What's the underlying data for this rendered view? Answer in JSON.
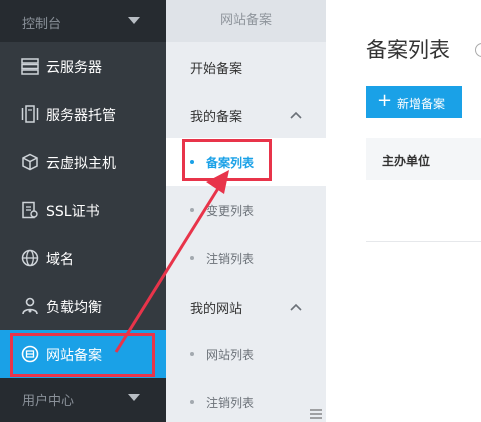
{
  "sidebar": {
    "console_label": "控制台",
    "items": [
      {
        "label": "云服务器",
        "icon": "server-list-icon"
      },
      {
        "label": "服务器托管",
        "icon": "server-hosting-icon"
      },
      {
        "label": "云虚拟主机",
        "icon": "cube-icon"
      },
      {
        "label": "SSL证书",
        "icon": "certificate-icon"
      },
      {
        "label": "域名",
        "icon": "globe-icon"
      },
      {
        "label": "负载均衡",
        "icon": "load-balance-icon"
      },
      {
        "label": "网站备案",
        "icon": "filing-icon",
        "active": true
      }
    ],
    "user_center_label": "用户中心",
    "active_color": "#1aa1e7"
  },
  "subnav": {
    "title": "网站备案",
    "start_filing": "开始备案",
    "my_filings": {
      "label": "我的备案",
      "items": [
        "备案列表",
        "变更列表",
        "注销列表"
      ]
    },
    "my_sites": {
      "label": "我的网站",
      "items": [
        "网站列表",
        "注销列表"
      ]
    }
  },
  "main": {
    "title": "备案列表",
    "add_button": "新增备案",
    "table": {
      "columns": [
        "主办单位"
      ]
    }
  },
  "annotation": {
    "color": "#e8344a"
  }
}
